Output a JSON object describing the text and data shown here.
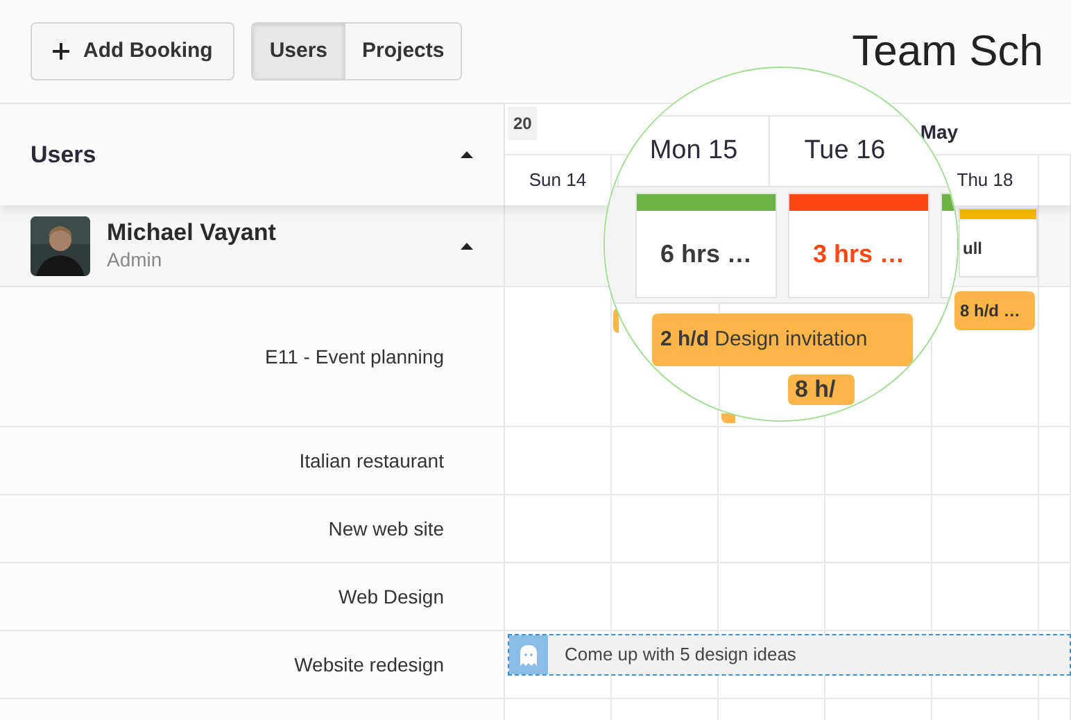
{
  "toolbar": {
    "add_button": "Add Booking",
    "view_tabs": [
      {
        "label": "Users",
        "selected": true
      },
      {
        "label": "Projects",
        "selected": false
      }
    ],
    "title": "Team Sch"
  },
  "header": {
    "column_title": "Users",
    "week": "20",
    "month": "May",
    "days": [
      "Sun 14",
      "Thu 18"
    ]
  },
  "user": {
    "name": "Michael Vayant",
    "role": "Admin",
    "expanded": true,
    "thu_summary": {
      "text": "ull",
      "color": "#f5b800"
    }
  },
  "projects": [
    {
      "name": "E11 - Event planning",
      "booking": "8 h/d …"
    },
    {
      "name": "Italian restaurant"
    },
    {
      "name": "New web site"
    },
    {
      "name": "Web Design"
    },
    {
      "name": "Website redesign",
      "task": "Come up with 5 design ideas"
    }
  ],
  "magnifier": {
    "days": [
      "Mon 15",
      "Tue 16"
    ],
    "summaries": [
      {
        "text": "6 hrs …",
        "color": "#6ab344",
        "over": false
      },
      {
        "text": "3 hrs …",
        "color": "#ff4713",
        "over": true
      }
    ],
    "bookings": [
      {
        "hours": "2 h/d",
        "title": "Design invitation"
      },
      {
        "hours": "8 h/"
      }
    ]
  }
}
